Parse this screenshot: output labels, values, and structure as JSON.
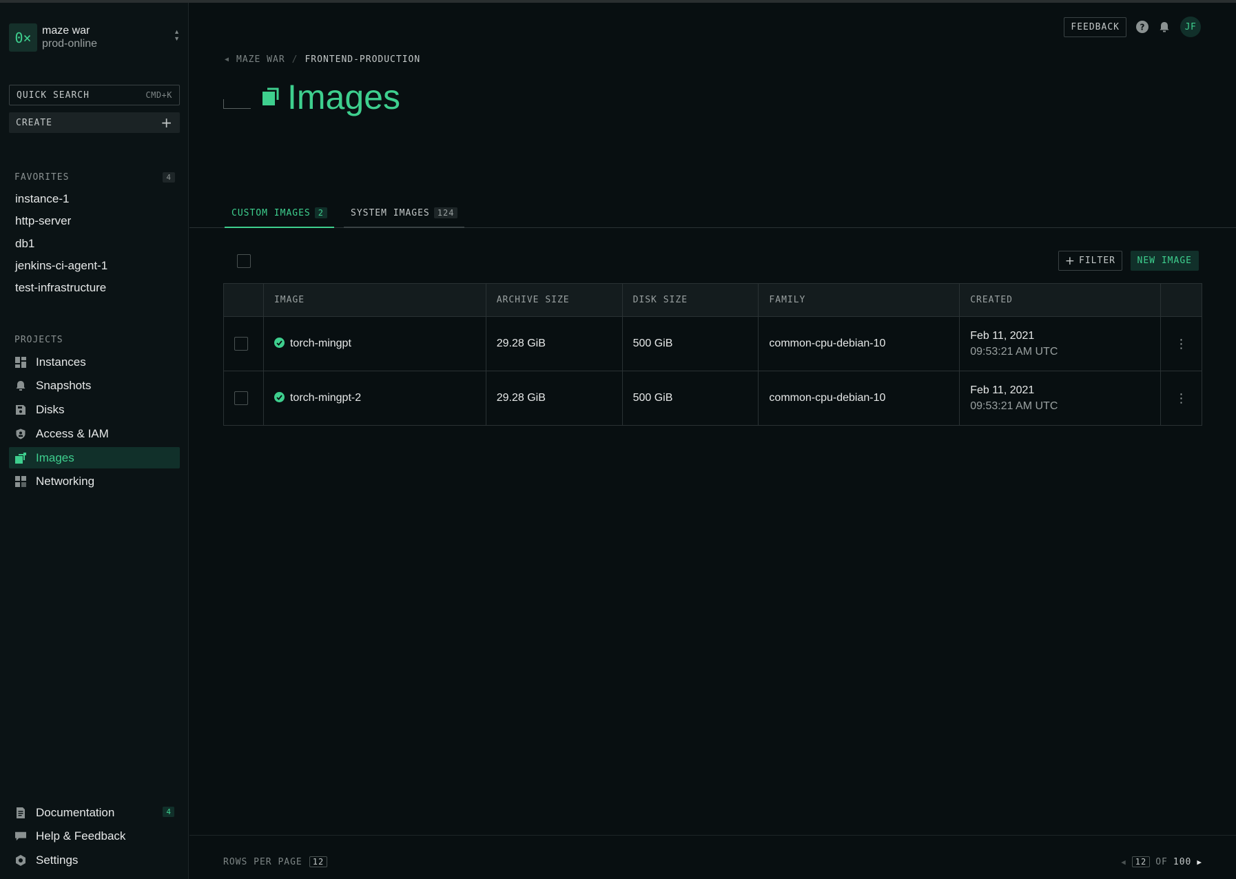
{
  "org": {
    "logo": "0×",
    "name": "maze war",
    "project": "prod-online"
  },
  "sidebar": {
    "search": {
      "placeholder": "QUICK SEARCH",
      "shortcut": "CMD+K"
    },
    "create_label": "CREATE",
    "favorites": {
      "heading": "FAVORITES",
      "count": "4",
      "items": [
        "instance-1",
        "http-server",
        "db1",
        "jenkins-ci-agent-1",
        "test-infrastructure"
      ]
    },
    "projects": {
      "heading": "PROJECTS",
      "items": [
        {
          "label": "Instances",
          "icon": "instances-icon"
        },
        {
          "label": "Snapshots",
          "icon": "snapshots-icon"
        },
        {
          "label": "Disks",
          "icon": "disk-icon"
        },
        {
          "label": "Access & IAM",
          "icon": "shield-icon"
        },
        {
          "label": "Images",
          "icon": "images-icon",
          "active": true
        },
        {
          "label": "Networking",
          "icon": "networking-icon"
        }
      ]
    },
    "bottom": {
      "documentation": {
        "label": "Documentation",
        "badge": "4"
      },
      "help": {
        "label": "Help & Feedback"
      },
      "settings": {
        "label": "Settings"
      }
    }
  },
  "topbar": {
    "feedback_label": "FEEDBACK",
    "avatar_initials": "JF"
  },
  "breadcrumb": {
    "parent": "MAZE WAR",
    "current": "FRONTEND-PRODUCTION"
  },
  "page": {
    "title": "Images"
  },
  "tabs": [
    {
      "label": "CUSTOM IMAGES",
      "count": "2",
      "active": true
    },
    {
      "label": "SYSTEM IMAGES",
      "count": "124",
      "active": false
    }
  ],
  "toolbar": {
    "filter_label": "FILTER",
    "new_image_label": "NEW IMAGE"
  },
  "table": {
    "columns": [
      "IMAGE",
      "ARCHIVE SIZE",
      "DISK SIZE",
      "FAMILY",
      "CREATED"
    ],
    "rows": [
      {
        "image": "torch-mingpt",
        "archive_size": "29.28 GiB",
        "disk_size": "500 GiB",
        "family": "common-cpu-debian-10",
        "created_date": "Feb 11, 2021",
        "created_time": "09:53:21 AM UTC"
      },
      {
        "image": "torch-mingpt-2",
        "archive_size": "29.28 GiB",
        "disk_size": "500 GiB",
        "family": "common-cpu-debian-10",
        "created_date": "Feb 11, 2021",
        "created_time": "09:53:21 AM UTC"
      }
    ]
  },
  "footer": {
    "rows_per_page_label": "ROWS PER PAGE",
    "rows_per_page": "12",
    "page_current": "12",
    "page_of": "OF",
    "page_total": "100"
  },
  "colors": {
    "accent": "#3ecf8e",
    "background": "#080f11",
    "sidebar": "#0b1315"
  }
}
